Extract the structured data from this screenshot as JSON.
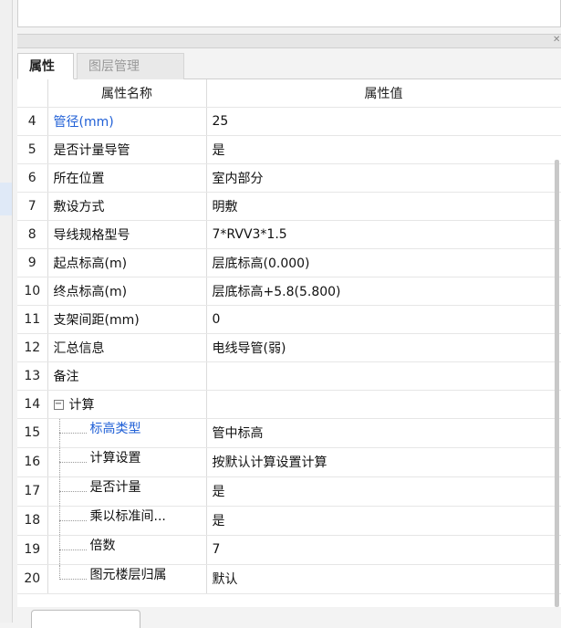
{
  "tabs": {
    "properties": "属性",
    "layers": "图层管理"
  },
  "headers": {
    "name": "属性名称",
    "value": "属性值"
  },
  "rows": [
    {
      "num": "4",
      "name": "管径(mm)",
      "value": "25"
    },
    {
      "num": "5",
      "name": "是否计量导管",
      "value": "是"
    },
    {
      "num": "6",
      "name": "所在位置",
      "value": "室内部分"
    },
    {
      "num": "7",
      "name": "敷设方式",
      "value": "明敷"
    },
    {
      "num": "8",
      "name": "导线规格型号",
      "value": "7*RVV3*1.5"
    },
    {
      "num": "9",
      "name": "起点标高(m)",
      "value": "层底标高(0.000)"
    },
    {
      "num": "10",
      "name": "终点标高(m)",
      "value": "层底标高+5.8(5.800)"
    },
    {
      "num": "11",
      "name": "支架间距(mm)",
      "value": "0"
    },
    {
      "num": "12",
      "name": "汇总信息",
      "value": "电线导管(弱)"
    },
    {
      "num": "13",
      "name": "备注",
      "value": ""
    },
    {
      "num": "14",
      "name": "计算",
      "value": ""
    },
    {
      "num": "15",
      "name": "标高类型",
      "value": "管中标高"
    },
    {
      "num": "16",
      "name": "计算设置",
      "value": "按默认计算设置计算"
    },
    {
      "num": "17",
      "name": "是否计量",
      "value": "是"
    },
    {
      "num": "18",
      "name": "乘以标准间...",
      "value": "是"
    },
    {
      "num": "19",
      "name": "倍数",
      "value": "7"
    },
    {
      "num": "20",
      "name": "图元楼层归属",
      "value": "默认"
    }
  ],
  "colors": {
    "link_blue": "#1f5fd6"
  }
}
